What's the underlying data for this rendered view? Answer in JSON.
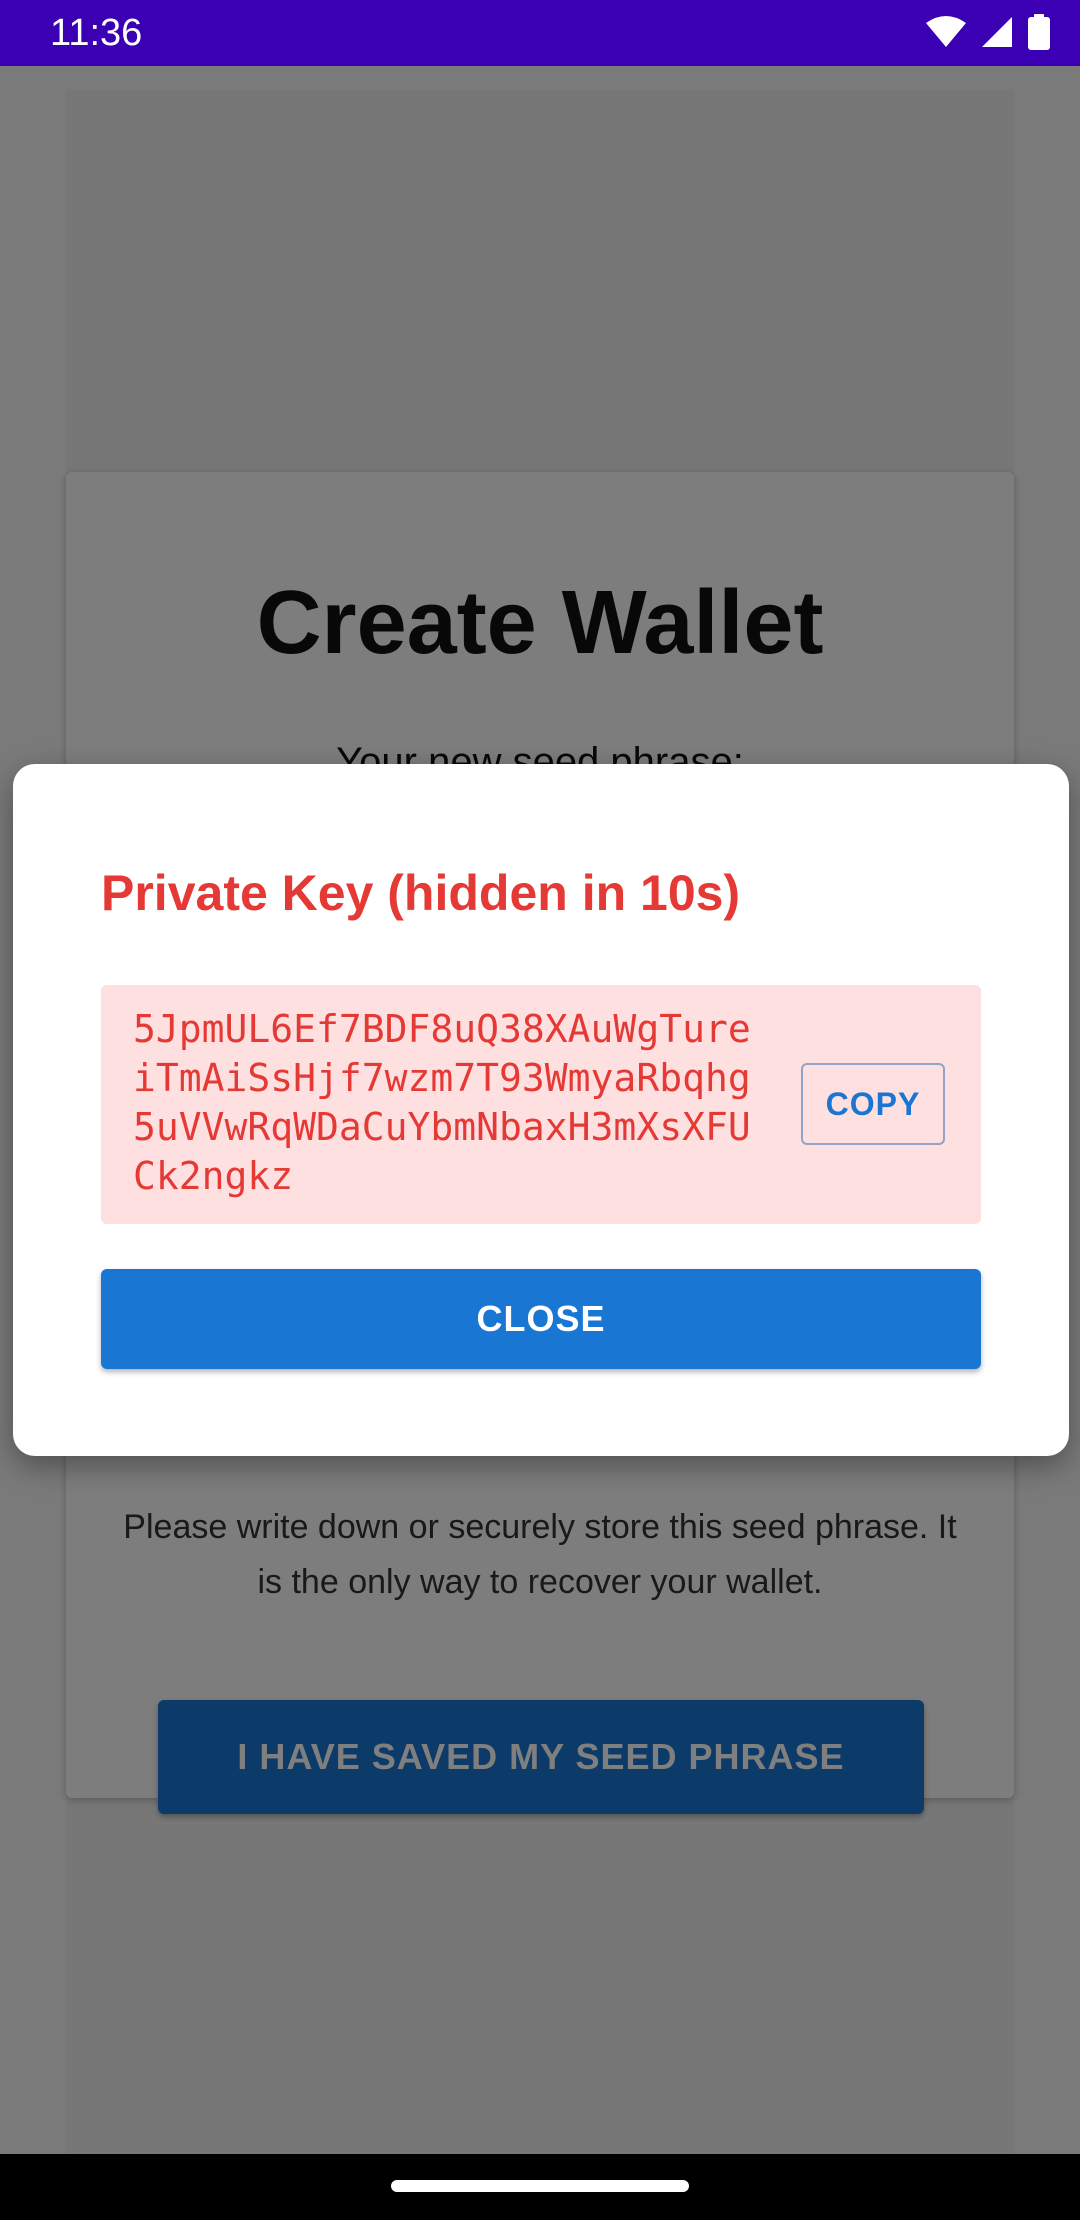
{
  "status_bar": {
    "time": "11:36",
    "icons": [
      "wifi-icon",
      "signal-icon",
      "battery-icon"
    ]
  },
  "app": {
    "title": "Create Wallet",
    "subtitle": "Your new seed phrase:",
    "instructions": "Please write down or securely store this seed phrase. It is the only way to recover your wallet.",
    "saved_button_label": "I HAVE SAVED MY SEED PHRASE"
  },
  "dialog": {
    "title": "Private Key (hidden in 10s)",
    "private_key": "5JpmUL6Ef7BDF8uQ38XAuWgTureiTmAiSsHjf7wzm7T93WmyaRbqhg5uVVwRqWDaCuYbmNbaxH3mXsXFUCk2ngkz",
    "copy_label": "COPY",
    "close_label": "CLOSE"
  },
  "colors": {
    "status_bar": "#3b00b3",
    "accent": "#1976d2",
    "danger": "#e53935",
    "key_background": "#ffe0e0"
  }
}
